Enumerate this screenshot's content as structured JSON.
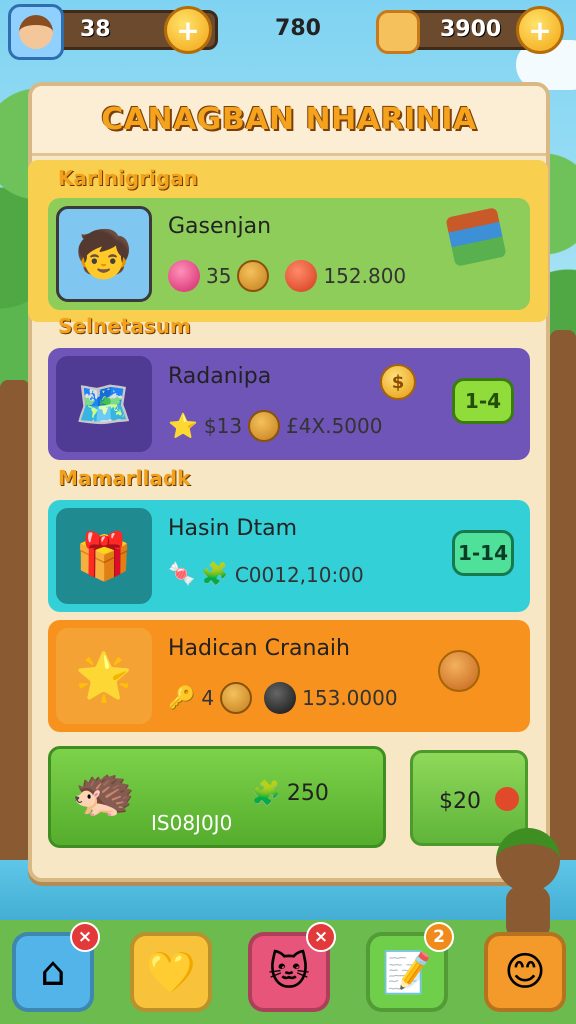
{
  "hud": {
    "left_value": "38",
    "center_value": "780",
    "right_value": "3900",
    "plus_symbol": "+"
  },
  "panel": {
    "title": "CANAGBAN NHARINIA"
  },
  "sections": [
    {
      "label": "Karlnigrigan"
    },
    {
      "label": "Selnetasum"
    },
    {
      "label": "Mamarlladk"
    }
  ],
  "cards": [
    {
      "name": "Gasenjan",
      "stat1": "35",
      "stat2": "152.800",
      "color": "#8fcd5b"
    },
    {
      "name": "Radanipa",
      "stat1": "$13",
      "stat2": "£4X.5000",
      "button": "1-4",
      "color": "#6f55b8"
    },
    {
      "name": "Hasin Dtam",
      "stat1": "C0012,10:00",
      "button": "1-14",
      "color": "#34d0d8"
    },
    {
      "name": "Hadican Cranaih",
      "stat1": "4",
      "stat2": "153.0000",
      "color": "#f7921e"
    }
  ],
  "bottom_cards": {
    "big_value": "250",
    "big_sub": "IS08J0J0",
    "small_value": "$20"
  },
  "nav": {
    "badges": [
      "×",
      "×",
      "2"
    ]
  },
  "colors": {
    "title": "#f5a31c",
    "card_green": "#8fcd5b",
    "card_purple": "#6f55b8",
    "card_cyan": "#34d0d8",
    "card_orange": "#f7921e"
  },
  "icons": [
    "avatar-icon",
    "plus-icon",
    "coin-icon",
    "gem-icon",
    "balloon-icon",
    "bomb-icon",
    "dollar-icon",
    "home-icon",
    "heart-icon",
    "pet-icon",
    "edit-icon",
    "smile-icon"
  ]
}
